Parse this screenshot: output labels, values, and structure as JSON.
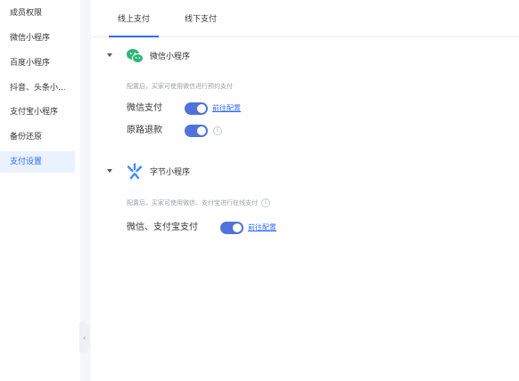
{
  "sidebar": {
    "items": [
      {
        "label": "成员权限"
      },
      {
        "label": "微信小程序"
      },
      {
        "label": "百度小程序"
      },
      {
        "label": "抖音、头条小..."
      },
      {
        "label": "支付宝小程序"
      },
      {
        "label": "备份还原"
      },
      {
        "label": "支付设置",
        "active": true
      }
    ],
    "collapse_icon": "‹"
  },
  "tabs": [
    {
      "label": "线上支付",
      "active": true
    },
    {
      "label": "线下支付",
      "active": false
    }
  ],
  "sections": [
    {
      "title": "微信小程序",
      "icon": "wechat-mini-program-icon",
      "hint": "配置后，买家可使用微信进行预约支付",
      "rows": [
        {
          "label": "微信支付",
          "enabled": true,
          "link": "前往配置"
        },
        {
          "label": "原路退款",
          "enabled": true,
          "info": "i"
        }
      ]
    },
    {
      "title": "字节小程序",
      "icon": "bytedance-mini-program-icon",
      "hint": "配置后，买家可使用微信、支付宝进行在线支付",
      "hint_info": "i",
      "rows": [
        {
          "label": "微信、支付宝支付",
          "enabled": true,
          "link": "前往配置"
        }
      ]
    }
  ],
  "colors": {
    "accent": "#2f6bff",
    "toggle_on": "#4f73d9",
    "wechat_green": "#2bb673",
    "bytedance_blue": "#3c8cff",
    "sidebar_active_bg": "#eaf1ff"
  }
}
